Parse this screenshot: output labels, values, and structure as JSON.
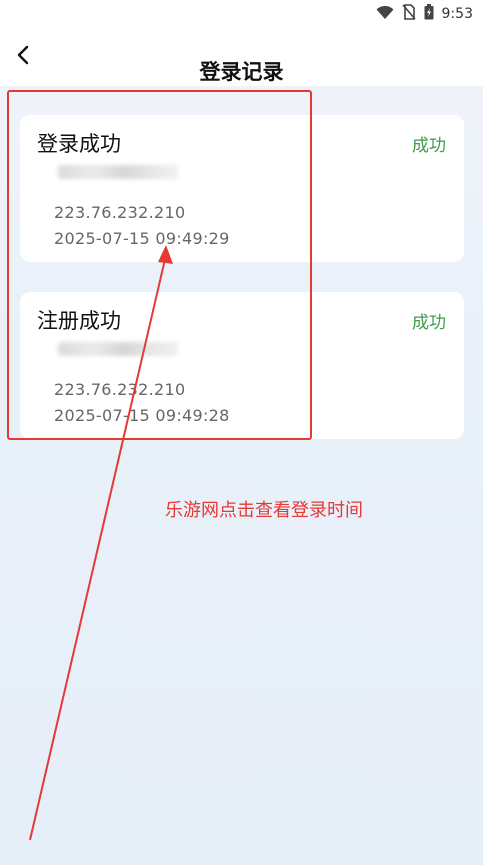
{
  "status_bar": {
    "time": "9:53",
    "icons": [
      "wifi-icon",
      "no-sim-icon",
      "battery-charging-icon"
    ]
  },
  "header": {
    "title": "登录记录",
    "back_icon": "chevron-left-icon"
  },
  "records": [
    {
      "title": "登录成功",
      "status": "成功",
      "ip": "223.76.232.210",
      "time": "2025-07-15 09:49:29"
    },
    {
      "title": "注册成功",
      "status": "成功",
      "ip": "223.76.232.210",
      "time": "2025-07-15 09:49:28"
    }
  ],
  "annotation": {
    "text": "乐游网点击查看登录时间",
    "color": "#e53935"
  },
  "colors": {
    "status_success": "#3f9a4b",
    "annotation": "#e53935"
  }
}
